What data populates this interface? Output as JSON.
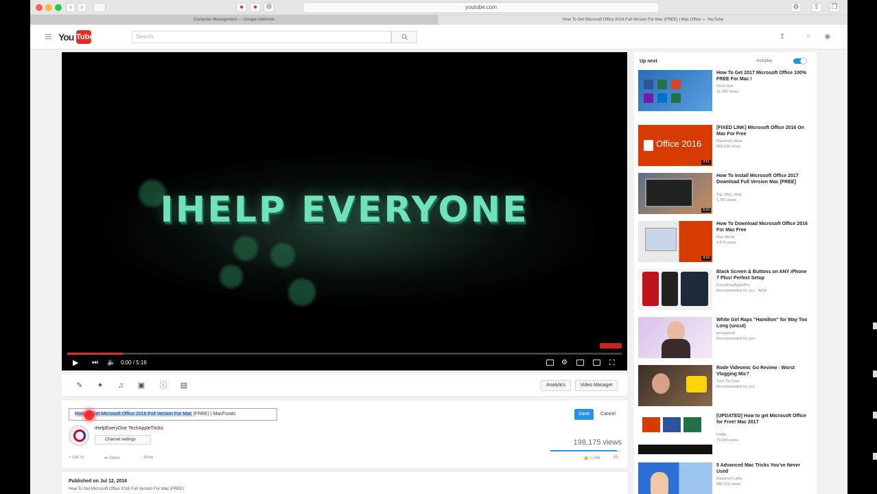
{
  "browser": {
    "url": "youtube.com",
    "tabs": [
      "Computer Management — Google AdWords",
      "How To Get Microsoft Office 2016 Full Version For Mac (FREE) | Mac Office — YouTube"
    ]
  },
  "header": {
    "logo_you": "You",
    "logo_tube": "Tube",
    "search_placeholder": "Search"
  },
  "player": {
    "overlay_text": "IHELP EVERYONE",
    "time": "0:00 / 5:16",
    "progress": 0.1
  },
  "editor": {
    "analytics_label": "Analytics",
    "video_manager_label": "Video Manager"
  },
  "info": {
    "title_highlighted": "How To Get Microsoft Office 2016 Full Version For Mac",
    "title_rest": " (FREE) | MacFoods",
    "save_label": "Save",
    "cancel_label": "Cancel",
    "channel_name": "iHelpEveryOne TechAppleTricks",
    "channel_settings_label": "Channel settings",
    "views": "198,175 views",
    "views_ratio": 0.95,
    "add_to_label": "Add to",
    "share_label": "Share",
    "more_label": "More",
    "likes": "1,058",
    "dislikes": "89",
    "published": "Published on Jul 12, 2016",
    "description": "How To Get Microsoft Office 2016 Full Version For Mac (FREE)"
  },
  "sidebar": {
    "up_next_label": "Up next",
    "autoplay_label": "Autoplay",
    "items": [
      {
        "title": "How To Get 2017 Microsoft Office 100% FREE For Mac !",
        "channel": "iTech Hub",
        "meta": "21,009 views",
        "duration": ""
      },
      {
        "title": "[FIXED LINK] Microsoft Office 2016 On Mac For Free",
        "channel": "Mastered Ideas",
        "meta": "869,516 views",
        "duration": "3:51"
      },
      {
        "title": "How To Install Microsoft Office 2017 Download Full Version Mac [FREE]",
        "channel": "Top_Mac_Help",
        "meta": "1,781 views",
        "duration": "5:10"
      },
      {
        "title": "How To Download Microsoft Office 2016 For Mac Free",
        "channel": "Mac World",
        "meta": "4,575 views",
        "duration": "4:16"
      },
      {
        "title": "Black Screen & Buttons on ANY iPhone 7 Plus! Perfect Setup",
        "channel": "EverythingApplePro",
        "meta": "Recommended for you · NEW",
        "duration": ""
      },
      {
        "title": "White Girl Raps \"Hamilton\" for Way Too Long (uncut)",
        "channel": "jennapoodl",
        "meta": "Recommended for you",
        "duration": ""
      },
      {
        "title": "Rode Videomic Go Review - Worst Vlogging Mic?",
        "channel": "Tech Tip Stop",
        "meta": "Recommended for you",
        "duration": ""
      },
      {
        "title": "[UPDATED] How to get Microsoft Office for Free! Mac 2017",
        "channel": "FibMe",
        "meta": "79,000 views",
        "duration": ""
      },
      {
        "title": "5 Advanced Mac Tricks You've Never Used",
        "channel": "Mastered Lattic",
        "meta": "886,516 views",
        "duration": ""
      }
    ]
  }
}
